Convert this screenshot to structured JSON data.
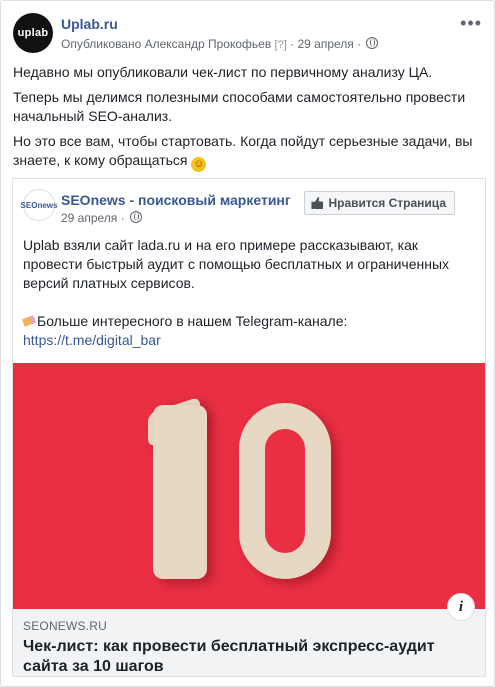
{
  "post": {
    "avatar_text": "uplab",
    "page_name": "Uplab.ru",
    "published_by": "Опубликовано Александр Прокофьев",
    "help_mark": "[?]",
    "date": "29 апреля",
    "more_icon": "more-dots-icon",
    "paragraphs": [
      "Недавно мы опубликовали чек-лист по первичному анализу ЦА.",
      "Теперь мы делимся полезными способами самостоятельно провести начальный SEO-анализ.",
      "Но это все вам, чтобы стартовать. Когда пойдут серьезные задачи, вы знаете, к кому обращаться"
    ],
    "emoji_icon": "smile-emoji-icon"
  },
  "shared": {
    "avatar_text": "SEOnews",
    "page_name": "SEOnews - поисковый маркетинг",
    "date": "29 апреля",
    "like_button": "Нравится Страница",
    "text_1": "Uplab взяли сайт lada.ru и на его примере рассказывают, как провести быстрый аудит с помощью бесплатных и ограниченных версий платных сервисов.",
    "text_2": "Больше интересного в нашем Telegram-канале:",
    "link": "https://t.me/digital_bar",
    "image_icon": "number-10-image",
    "domain": "SEONEWS.RU",
    "title": "Чек-лист: как провести бесплатный экспресс-аудит сайта за 10 шагов",
    "info_label": "i"
  }
}
